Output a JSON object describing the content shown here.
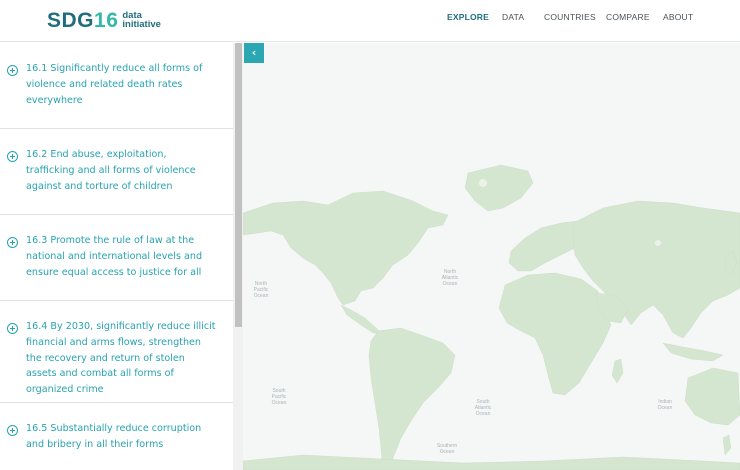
{
  "logo": {
    "main": "SDG",
    "number": "16",
    "subtitle": "data initiative"
  },
  "nav": {
    "explore": "EXPLORE",
    "data": "DATA",
    "countries": "COUNTRIES",
    "compare": "COMPARE",
    "about": "ABOUT"
  },
  "targets": [
    {
      "label": "16.1 Significantly reduce all forms of violence and related death rates everywhere"
    },
    {
      "label": "16.2 End abuse, exploitation, trafficking and all forms of violence against and torture of children"
    },
    {
      "label": "16.3 Promote the rule of law at the national and international levels and ensure equal access to justice for all"
    },
    {
      "label": "16.4 By 2030, significantly reduce illicit financial and arms flows, strengthen the recovery and return of stolen assets and combat all forms of organized crime"
    },
    {
      "label": "16.5 Substantially reduce corruption and bribery in all their forms"
    }
  ],
  "map": {
    "collapse_icon": "chevron-left-icon",
    "land_color": "#d5e6d0",
    "oceans": {
      "north_pacific": "North Pacific Ocean",
      "north_atlantic": "North Atlantic Ocean",
      "south_pacific": "South Pacific Ocean",
      "south_atlantic": "South Atlantic Ocean",
      "indian": "Indian Ocean",
      "southern": "Southern Ocean"
    }
  },
  "colors": {
    "accent": "#27a3b0",
    "brand_dark": "#1f6e7e",
    "brand_light": "#35b8a6"
  }
}
